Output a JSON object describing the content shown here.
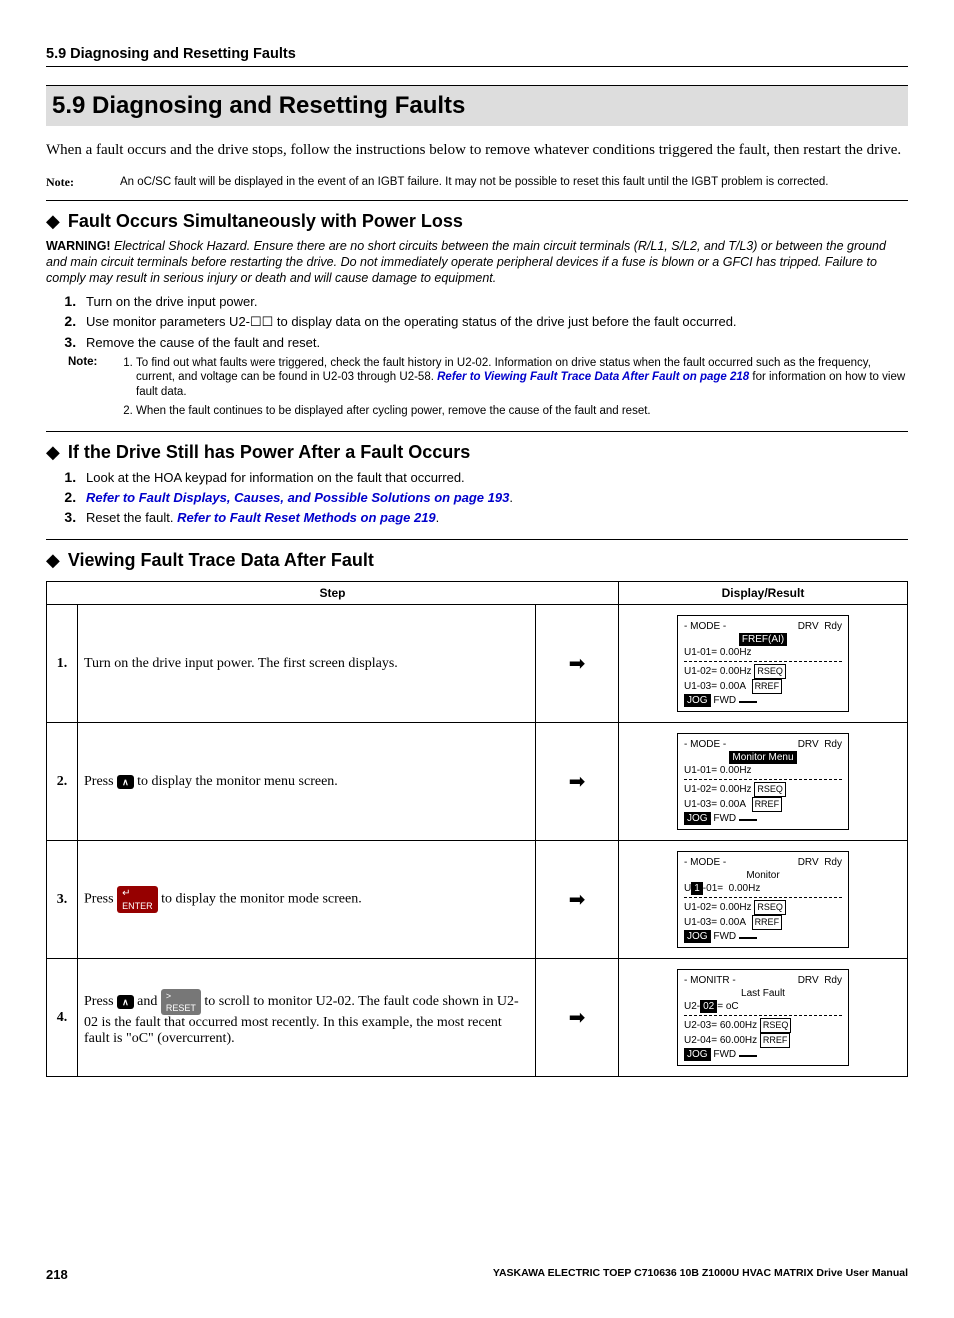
{
  "runningHeader": "5.9 Diagnosing and Resetting Faults",
  "sectionTitle": "5.9   Diagnosing and Resetting Faults",
  "intro": "When a fault occurs and the drive stops, follow the instructions below to remove whatever conditions triggered the fault, then restart the drive.",
  "noteA": {
    "label": "Note:",
    "body": "An oC/SC fault will be displayed in the event of an IGBT failure. It may not be possible to reset this fault until the IGBT problem is corrected."
  },
  "hA": "Fault Occurs Simultaneously with Power Loss",
  "warn": {
    "label": "WARNING!",
    "body": " Electrical Shock Hazard. Ensure there are no short circuits between the main circuit terminals (R/L1, S/L2, and T/L3) or between the ground and main circuit terminals before restarting the drive. Do not immediately operate peripheral devices if a fuse is blown or a GFCI has tripped. Failure to comply may result in serious injury or death and will cause damage to equipment."
  },
  "stepsA": [
    "Turn on the drive input power.",
    "Use monitor parameters U2-☐☐ to display data on the operating status of the drive just before the fault occurred.",
    "Remove the cause of the fault and reset."
  ],
  "noteB": {
    "label": "Note:",
    "items": [
      {
        "pre": "To find out what faults were triggered, check the fault history in U2-02. Information on drive status when the fault occurred such as the frequency, current, and voltage can be found in U2-03 through U2-58. ",
        "link": "Refer to Viewing Fault Trace Data After Fault on page 218",
        "post": " for information on how to view fault data."
      },
      {
        "pre": "When the fault continues to be displayed after cycling power, remove the cause of the fault and reset.",
        "link": "",
        "post": ""
      }
    ]
  },
  "hB": "If the Drive Still has Power After a Fault Occurs",
  "stepsB": {
    "s1": "Look at the HOA keypad for information on the fault that occurred.",
    "s2link": "Refer to Fault Displays, Causes, and Possible Solutions on page 193",
    "s3pre": "Reset the fault. ",
    "s3link": "Refer to Fault Reset Methods on page 219"
  },
  "hC": "Viewing Fault Trace Data After Fault",
  "table": {
    "h1": "Step",
    "h2": "Display/Result",
    "rows": [
      {
        "n": "1.",
        "desc": "Turn on the drive input power. The first screen displays.",
        "lcd": {
          "mode": "- MODE -",
          "drv": "DRV",
          "rdy": "Rdy",
          "line2inv": "FREF(AI)",
          "l3": "U1-01=  0.00Hz",
          "l4a": "U1-02=  0.00Hz",
          "l4b": "RSEQ",
          "l5a": "U1-03=  0.00A",
          "l5b": "RREF",
          "jog": "JOG",
          "fwd": "FWD"
        }
      },
      {
        "n": "2.",
        "descPre": "Press ",
        "key": "up",
        "descPost": " to display the monitor menu screen.",
        "lcd": {
          "mode": "- MODE -",
          "drv": "DRV",
          "rdy": "Rdy",
          "line2inv": "Monitor Menu",
          "l3": "U1-01=  0.00Hz",
          "l4a": "U1-02=  0.00Hz",
          "l4b": "RSEQ",
          "l5a": "U1-03=  0.00A",
          "l5b": "RREF",
          "jog": "JOG",
          "fwd": "FWD"
        }
      },
      {
        "n": "3.",
        "descPre": "Press ",
        "key": "enter",
        "keyLabel": "ENTER",
        "descPost": " to display the monitor mode screen.",
        "lcd": {
          "mode": "- MODE -",
          "drv": "DRV",
          "rdy": "Rdy",
          "line2plain": "Monitor",
          "l3": "U1-01=  0.00Hz",
          "l3cursor": true,
          "l4a": "U1-02=  0.00Hz",
          "l4b": "RSEQ",
          "l5a": "U1-03=  0.00A",
          "l5b": "RREF",
          "jog": "JOG",
          "fwd": "FWD"
        }
      },
      {
        "n": "4.",
        "descPre": "Press ",
        "key1": "up",
        "mid": " and ",
        "key2": "reset",
        "key2Label": "RESET",
        "descPost": " to scroll to monitor U2-02. The fault code shown in U2-02 is the fault that occurred most recently. In this example, the most recent fault is \"oC\" (overcurrent).",
        "lcd": {
          "mode": "- MONITR -",
          "drv": "DRV",
          "rdy": "Rdy",
          "line2plain": "Last Fault",
          "l3pre": "U2-",
          "l3inv": "02",
          "l3post": "=  oC",
          "l4a": "U2-03= 60.00Hz",
          "l4b": "RSEQ",
          "l5a": "U2-04= 60.00Hz",
          "l5b": "RREF",
          "jog": "JOG",
          "fwd": "FWD"
        }
      }
    ]
  },
  "footer": {
    "page": "218",
    "manual": "YASKAWA ELECTRIC TOEP C710636 10B Z1000U HVAC MATRIX Drive User Manual"
  }
}
